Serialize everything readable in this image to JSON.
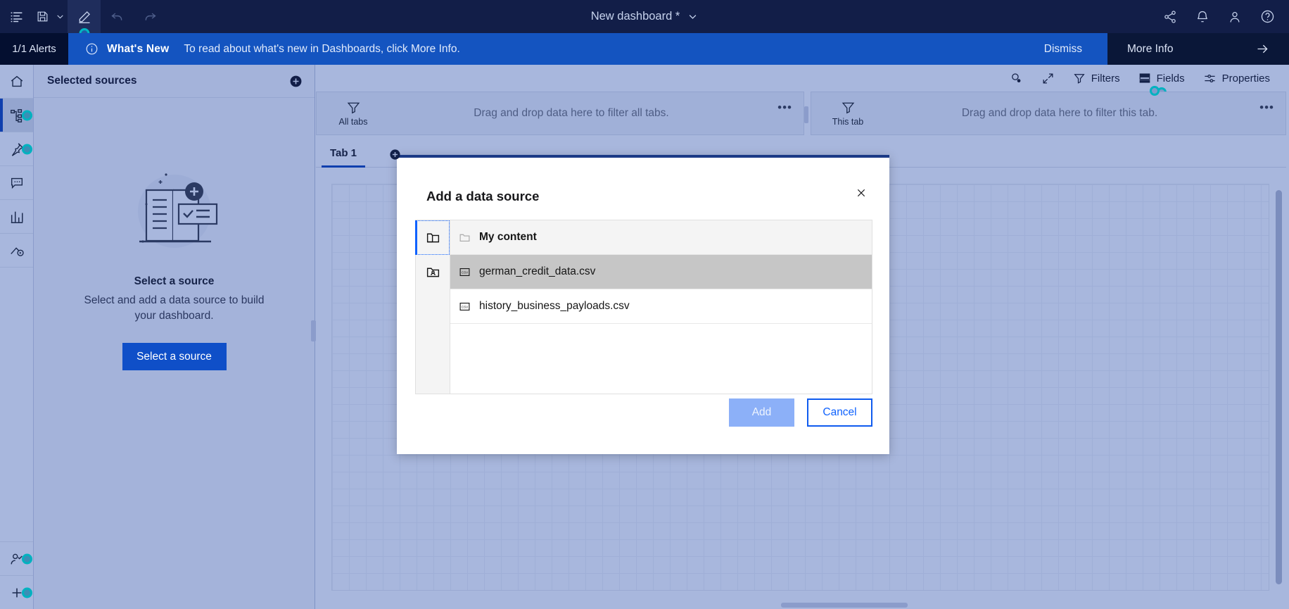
{
  "topbar": {
    "title": "New dashboard *",
    "icons": {
      "menu": "list-menu-icon",
      "save": "save-icon",
      "save_chevron": "chevron-down-icon",
      "edit": "pencil-icon",
      "undo": "undo-icon",
      "redo": "redo-icon",
      "share": "share-icon",
      "notifications": "bell-icon",
      "account": "user-icon",
      "help": "help-icon"
    }
  },
  "notification": {
    "alerts": "1/1 Alerts",
    "info_icon": "info-icon",
    "label": "What's New",
    "message": "To read about what's new in Dashboards, click More Info.",
    "dismiss": "Dismiss",
    "more_info": "More Info",
    "arrow_icon": "arrow-right-icon"
  },
  "rail": {
    "items": [
      {
        "name": "home",
        "icon": "home-icon",
        "selected": false,
        "badge": false
      },
      {
        "name": "sources",
        "icon": "sources-tree-icon",
        "selected": true,
        "badge": true
      },
      {
        "name": "pinned",
        "icon": "pin-icon",
        "selected": false,
        "badge": true
      },
      {
        "name": "comments",
        "icon": "comment-icon",
        "selected": false,
        "badge": false
      },
      {
        "name": "visualizations",
        "icon": "bar-chart-icon",
        "selected": false,
        "badge": false
      },
      {
        "name": "assistant",
        "icon": "assistant-icon",
        "selected": false,
        "badge": false
      }
    ],
    "bottom_items": [
      {
        "name": "collaborate",
        "icon": "user-check-icon",
        "badge": true
      },
      {
        "name": "add-widget",
        "icon": "plus-icon",
        "badge": true
      }
    ]
  },
  "sources_panel": {
    "title": "Selected sources",
    "add_icon": "add-circle-icon",
    "empty": {
      "illustration": "select-source-illustration",
      "title": "Select a source",
      "text": "Select and add a data source to build your dashboard.",
      "button": "Select a source"
    }
  },
  "canvas_toolbar": {
    "items": [
      {
        "label": "",
        "icon": "search-icon",
        "badge": false
      },
      {
        "label": "",
        "icon": "expand-icon",
        "badge": false
      },
      {
        "label": "Filters",
        "icon": "filter-icon",
        "badge": false
      },
      {
        "label": "Fields",
        "icon": "fields-icon",
        "badge": true
      },
      {
        "label": "Properties",
        "icon": "properties-icon",
        "badge": false
      }
    ]
  },
  "filter_zones": [
    {
      "icon": "filter-icon",
      "label": "All tabs",
      "text": "Drag and drop data here to filter all tabs.",
      "overflow": "overflow-menu-icon"
    },
    {
      "icon": "filter-icon",
      "label": "This tab",
      "text": "Drag and drop data here to filter this tab.",
      "overflow": "overflow-menu-icon"
    }
  ],
  "tabs": {
    "items": [
      {
        "label": "Tab 1",
        "active": true
      }
    ],
    "add_icon": "add-circle-icon"
  },
  "modal": {
    "title": "Add a data source",
    "close_icon": "close-icon",
    "rail": [
      {
        "name": "my-content",
        "icon": "folder-icon",
        "selected": true
      },
      {
        "name": "team-content",
        "icon": "folder-user-icon",
        "selected": false
      }
    ],
    "breadcrumb": {
      "icon": "folder-outline-icon",
      "label": "My content"
    },
    "files": [
      {
        "icon": "csv-file-icon",
        "name": "german_credit_data.csv",
        "selected": true
      },
      {
        "icon": "csv-file-icon",
        "name": "history_business_payloads.csv",
        "selected": false
      }
    ],
    "buttons": {
      "add": "Add",
      "cancel": "Cancel",
      "add_disabled": true
    }
  },
  "colors": {
    "topbar": "#121e48",
    "notification": "#1454c0",
    "accent": "#0f62fe",
    "canvas": "#a8b7dd",
    "badge": "#00b2c0"
  }
}
